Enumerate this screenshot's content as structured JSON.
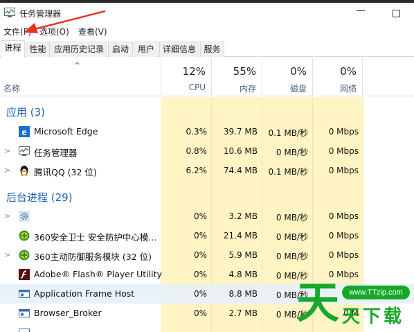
{
  "window": {
    "title": "任务管理器"
  },
  "menu": [
    "文件(F)",
    "选项(O)",
    "查看(V)"
  ],
  "tabs": [
    "进程",
    "性能",
    "应用历史记录",
    "启动",
    "用户",
    "详细信息",
    "服务"
  ],
  "active_tab": "进程",
  "columns": {
    "name": "名称",
    "cpu": {
      "pct": "12%",
      "label": "CPU"
    },
    "memory": {
      "pct": "55%",
      "label": "内存"
    },
    "disk": {
      "pct": "0%",
      "label": "磁盘"
    },
    "network": {
      "pct": "0%",
      "label": "网络"
    }
  },
  "groups": {
    "apps": "应用 (3)",
    "background": "后台进程 (29)"
  },
  "rows": [
    {
      "name": "Microsoft Edge",
      "cpu": "0.3%",
      "mem": "39.7 MB",
      "disk": "0.1 MB/秒",
      "net": "0 Mbps",
      "icon": "edge-icon"
    },
    {
      "name": "任务管理器",
      "cpu": "0.8%",
      "mem": "10.6 MB",
      "disk": "0 MB/秒",
      "net": "0 Mbps",
      "icon": "task-manager-icon"
    },
    {
      "name": "腾讯QQ (32 位)",
      "cpu": "6.2%",
      "mem": "74.4 MB",
      "disk": "0.1 MB/秒",
      "net": "0 Mbps",
      "icon": "qq-penguin-icon"
    },
    {
      "name": "",
      "cpu": "0%",
      "mem": "3.2 MB",
      "disk": "0 MB/秒",
      "net": "0 Mbps",
      "icon": "gear-icon"
    },
    {
      "name": "360安全卫士 安全防护中心模...",
      "cpu": "0%",
      "mem": "21.4 MB",
      "disk": "0 MB/秒",
      "net": "0 Mbps",
      "icon": "360-shield-icon"
    },
    {
      "name": "360主动防御服务模块 (32 位)",
      "cpu": "0%",
      "mem": "5.9 MB",
      "disk": "0 MB/秒",
      "net": "0 Mbps",
      "icon": "360-shield-icon"
    },
    {
      "name": "Adobe® Flash® Player Utility",
      "cpu": "0%",
      "mem": "4.8 MB",
      "disk": "0 MB/秒",
      "net": "0 Mbps",
      "icon": "flash-icon"
    },
    {
      "name": "Application Frame Host",
      "cpu": "0%",
      "mem": "8.8 MB",
      "disk": "0 MB/秒",
      "net": "0 M",
      "icon": "app-frame-icon"
    },
    {
      "name": "Browser_Broker",
      "cpu": "0%",
      "mem": "2.7 MB",
      "disk": "0 MB/秒",
      "net": "0 M",
      "icon": "app-frame-icon"
    }
  ],
  "watermark": {
    "logo_char": "天",
    "text": "天下载",
    "url": "www.TTzip.com"
  },
  "colors": {
    "heat": "#fff4c4",
    "group_text": "#1a5fb4",
    "arrow": "#e8302a",
    "watermark": "#17a82a"
  }
}
